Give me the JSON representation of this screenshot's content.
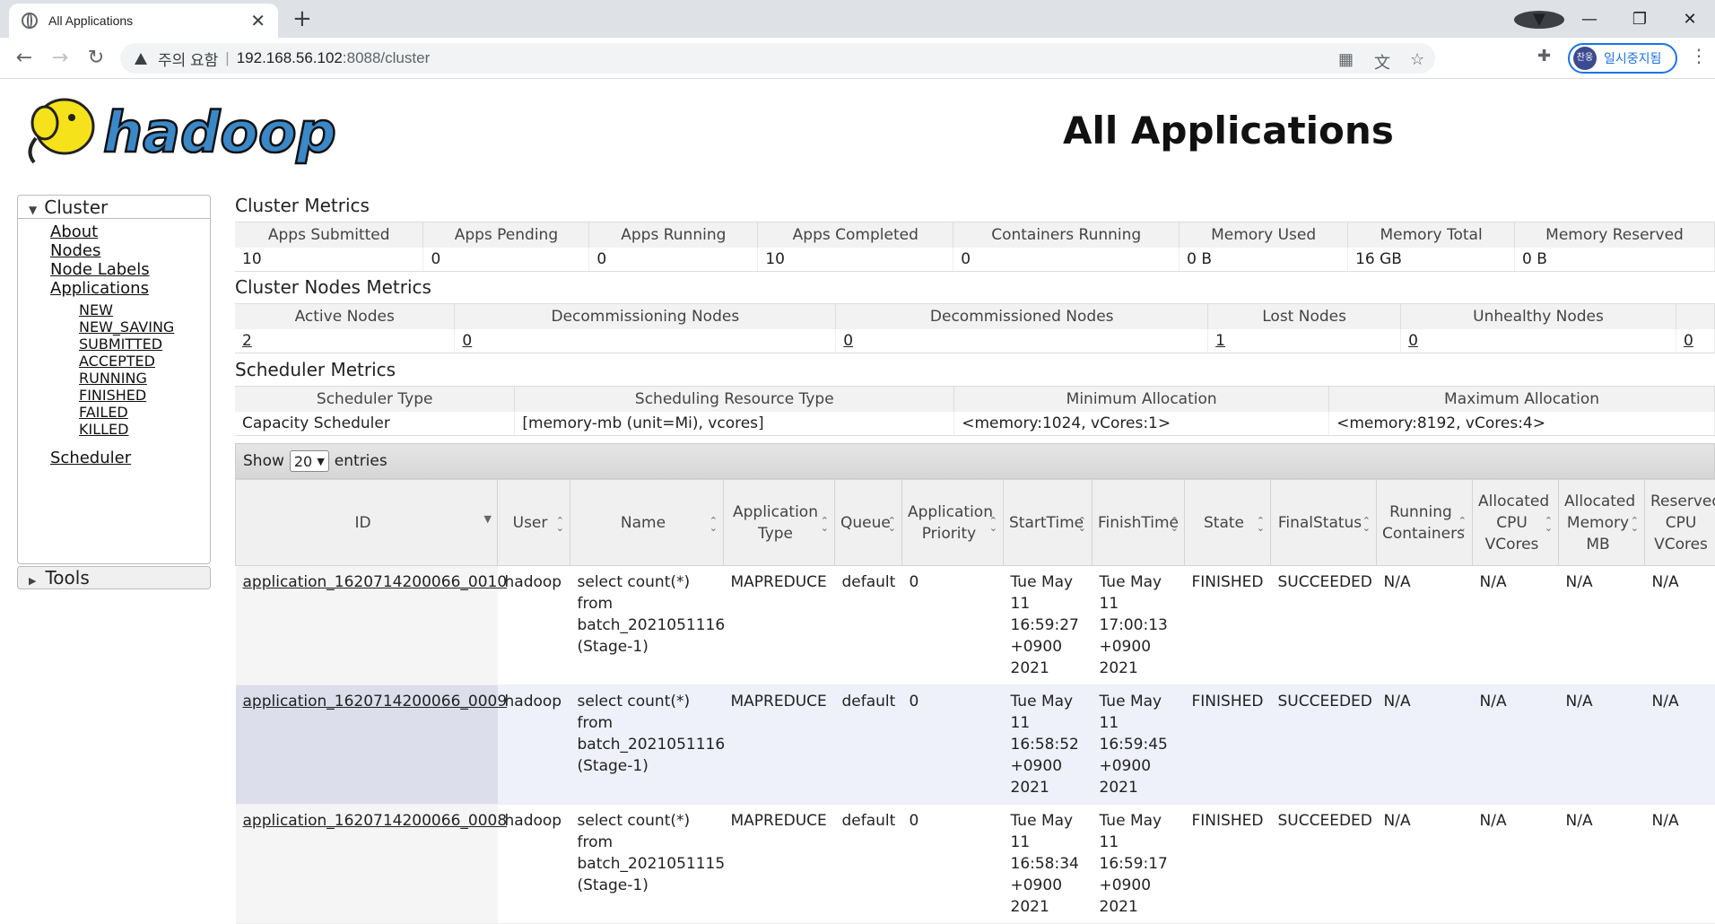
{
  "browser": {
    "tab_title": "All Applications",
    "tab_close": "✕",
    "new_tab": "+",
    "insecure_label": "주의 요함",
    "url_separator": "|",
    "url_host": "192.168.56.102",
    "url_path": ":8088/cluster",
    "profile_avatar": "찬웅",
    "profile_label": "일시중지됨",
    "icons": [
      "back-icon",
      "forward-icon",
      "reload-icon",
      "warning-icon",
      "qr-code-icon",
      "translate-icon",
      "star-icon",
      "extensions-icon",
      "menu-dots-icon"
    ]
  },
  "page": {
    "title": "All Applications",
    "logo_text": "hadoop"
  },
  "sidebar": {
    "cluster_label": "Cluster",
    "links": [
      "About",
      "Nodes",
      "Node Labels",
      "Applications"
    ],
    "app_states": [
      "NEW",
      "NEW_SAVING",
      "SUBMITTED",
      "ACCEPTED",
      "RUNNING",
      "FINISHED",
      "FAILED",
      "KILLED"
    ],
    "scheduler": "Scheduler",
    "tools_label": "Tools"
  },
  "cluster_metrics": {
    "title": "Cluster Metrics",
    "headers": [
      "Apps Submitted",
      "Apps Pending",
      "Apps Running",
      "Apps Completed",
      "Containers Running",
      "Memory Used",
      "Memory Total",
      "Memory Reserved"
    ],
    "values": [
      "10",
      "0",
      "0",
      "10",
      "0",
      "0 B",
      "16 GB",
      "0 B"
    ]
  },
  "cluster_nodes": {
    "title": "Cluster Nodes Metrics",
    "headers": [
      "Active Nodes",
      "Decommissioning Nodes",
      "Decommissioned Nodes",
      "Lost Nodes",
      "Unhealthy Nodes",
      ""
    ],
    "values": [
      "2",
      "0",
      "0",
      "1",
      "0",
      "0"
    ]
  },
  "scheduler_metrics": {
    "title": "Scheduler Metrics",
    "headers": [
      "Scheduler Type",
      "Scheduling Resource Type",
      "Minimum Allocation",
      "Maximum Allocation"
    ],
    "values": [
      "Capacity Scheduler",
      "[memory-mb (unit=Mi), vcores]",
      "<memory:1024, vCores:1>",
      "<memory:8192, vCores:4>"
    ]
  },
  "table_controls": {
    "show_label": "Show",
    "page_size": "20",
    "entries_label": "entries"
  },
  "apps_table": {
    "headers": [
      "ID",
      "User",
      "Name",
      "Application Type",
      "Queue",
      "Application Priority",
      "StartTime",
      "FinishTime",
      "State",
      "FinalStatus",
      "Running Containers",
      "Allocated CPU VCores",
      "Allocated Memory MB",
      "Reserved CPU VCores"
    ],
    "rows": [
      {
        "id": "application_1620714200066_0010",
        "user": "hadoop",
        "name": "select count(*) from batch_2021051116 (Stage-1)",
        "type": "MAPREDUCE",
        "queue": "default",
        "priority": "0",
        "start": "Tue May 11 16:59:27 +0900 2021",
        "finish": "Tue May 11 17:00:13 +0900 2021",
        "state": "FINISHED",
        "final_status": "SUCCEEDED",
        "running_containers": "N/A",
        "alloc_cpu": "N/A",
        "alloc_mem": "N/A",
        "reserved_cpu": "N/A"
      },
      {
        "id": "application_1620714200066_0009",
        "user": "hadoop",
        "name": "select count(*) from batch_2021051116 (Stage-1)",
        "type": "MAPREDUCE",
        "queue": "default",
        "priority": "0",
        "start": "Tue May 11 16:58:52 +0900 2021",
        "finish": "Tue May 11 16:59:45 +0900 2021",
        "state": "FINISHED",
        "final_status": "SUCCEEDED",
        "running_containers": "N/A",
        "alloc_cpu": "N/A",
        "alloc_mem": "N/A",
        "reserved_cpu": "N/A"
      },
      {
        "id": "application_1620714200066_0008",
        "user": "hadoop",
        "name": "select count(*) from batch_2021051115 (Stage-1)",
        "type": "MAPREDUCE",
        "queue": "default",
        "priority": "0",
        "start": "Tue May 11 16:58:34 +0900 2021",
        "finish": "Tue May 11 16:59:17 +0900 2021",
        "state": "FINISHED",
        "final_status": "SUCCEEDED",
        "running_containers": "N/A",
        "alloc_cpu": "N/A",
        "alloc_mem": "N/A",
        "reserved_cpu": "N/A"
      }
    ]
  }
}
